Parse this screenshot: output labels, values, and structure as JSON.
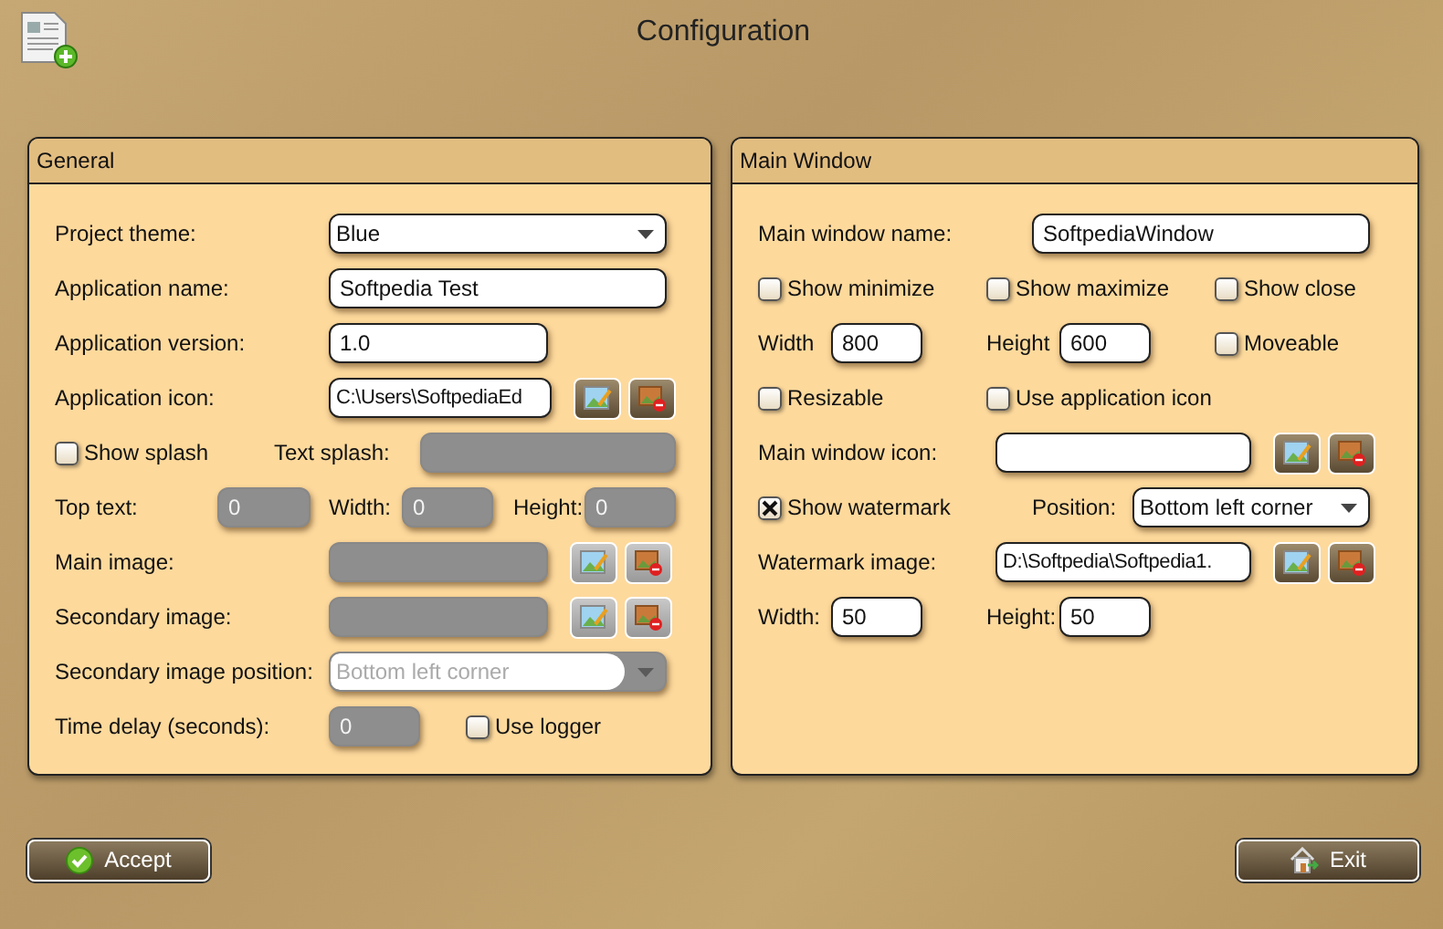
{
  "window": {
    "title": "Configuration"
  },
  "general": {
    "title": "General",
    "project_theme": {
      "label": "Project theme:",
      "value": "Blue",
      "disabled": false
    },
    "application_name": {
      "label": "Application name:",
      "value": "Softpedia Test"
    },
    "application_version": {
      "label": "Application version:",
      "value": "1.0"
    },
    "application_icon": {
      "label": "Application icon:",
      "value": "C:\\Users\\SoftpediaEd",
      "disabled": false
    },
    "show_splash": {
      "label": "Show splash",
      "checked": false
    },
    "text_splash": {
      "label": "Text splash:",
      "disabled": true
    },
    "top_text": {
      "label": "Top text:",
      "value": "0",
      "disabled": true
    },
    "width": {
      "label": "Width:",
      "value": "0",
      "disabled": true
    },
    "height": {
      "label": "Height:",
      "value": "0",
      "disabled": true
    },
    "main_image": {
      "label": "Main image:",
      "disabled": true
    },
    "secondary_image": {
      "label": "Secondary image:",
      "disabled": true
    },
    "secondary_image_position": {
      "label": "Secondary image position:",
      "value": "Bottom left corner",
      "disabled": true
    },
    "time_delay": {
      "label": "Time delay (seconds):",
      "value": "0",
      "disabled": true
    },
    "use_logger": {
      "label": "Use logger",
      "checked": false
    }
  },
  "main_window": {
    "title": "Main Window",
    "name": {
      "label": "Main window name:",
      "value": "SoftpediaWindow"
    },
    "show_minimize": {
      "label": "Show minimize",
      "checked": false
    },
    "show_maximize": {
      "label": "Show maximize",
      "checked": false
    },
    "show_close": {
      "label": "Show close",
      "checked": false
    },
    "width": {
      "label": "Width",
      "value": "800"
    },
    "height": {
      "label": "Height",
      "value": "600"
    },
    "moveable": {
      "label": "Moveable",
      "checked": false
    },
    "resizable": {
      "label": "Resizable",
      "checked": false
    },
    "use_application_icon": {
      "label": "Use application icon",
      "checked": false
    },
    "icon": {
      "label": "Main window icon:",
      "disabled": false
    },
    "show_watermark": {
      "label": "Show watermark",
      "checked": true
    },
    "position": {
      "label": "Position:",
      "value": "Bottom left corner",
      "disabled": false
    },
    "watermark_image": {
      "label": "Watermark image:",
      "value": "D:\\Softpedia\\Softpedia1.",
      "disabled": false
    },
    "watermark_width": {
      "label": "Width:",
      "value": "50"
    },
    "watermark_height": {
      "label": "Height:",
      "value": "50"
    }
  },
  "buttons": [
    {
      "kind": "accept",
      "label": "Accept"
    },
    {
      "kind": "exit",
      "label": "Exit"
    }
  ]
}
